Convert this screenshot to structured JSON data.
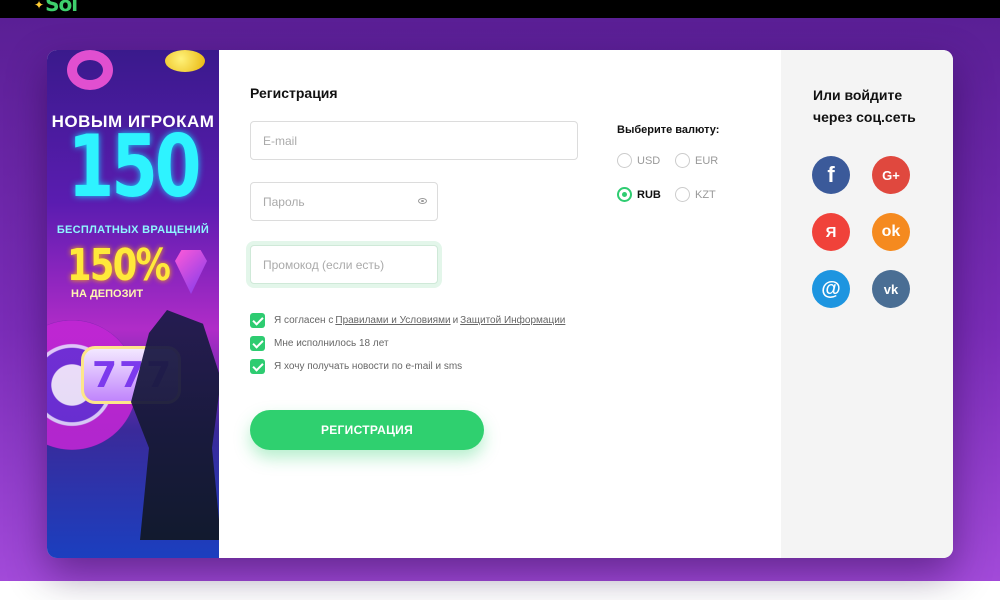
{
  "header": {
    "logo": "Sol"
  },
  "promo": {
    "line1": "НОВЫМ ИГРОКАМ",
    "line2": "150",
    "line3": "БЕСПЛАТНЫХ ВРАЩЕНИЙ",
    "line4": "150%",
    "line5": "НА ДЕПОЗИТ",
    "slot_symbols": "777"
  },
  "form": {
    "title": "Регистрация",
    "email_placeholder": "E-mail",
    "password_placeholder": "Пароль",
    "promocode_placeholder": "Промокод (если есть)",
    "currency_label": "Выберите валюту:",
    "currencies": [
      {
        "label": "USD",
        "selected": false
      },
      {
        "label": "EUR",
        "selected": false
      },
      {
        "label": "RUB",
        "selected": true
      },
      {
        "label": "KZT",
        "selected": false
      }
    ],
    "agree_prefix": "Я согласен с",
    "agree_link1": "Правилами и Условиями",
    "agree_and": "и",
    "agree_link2": "Защитой Информации",
    "age_check": "Мне исполнилось 18 лет",
    "news_check": "Я хочу получать новости по e-mail и sms",
    "submit_label": "РЕГИСТРАЦИЯ"
  },
  "social": {
    "title": "Или войдите через соц.сеть",
    "buttons": [
      {
        "icon": "facebook-icon",
        "glyph": "f"
      },
      {
        "icon": "google-plus-icon",
        "glyph": "G+"
      },
      {
        "icon": "yandex-icon",
        "glyph": "Я"
      },
      {
        "icon": "odnoklassniki-icon",
        "glyph": "ok"
      },
      {
        "icon": "mail-ru-icon",
        "glyph": "@"
      },
      {
        "icon": "vk-icon",
        "glyph": "vk"
      }
    ]
  },
  "colors": {
    "accent_green": "#2fd06f",
    "background_purple": "#7a2cb7"
  }
}
